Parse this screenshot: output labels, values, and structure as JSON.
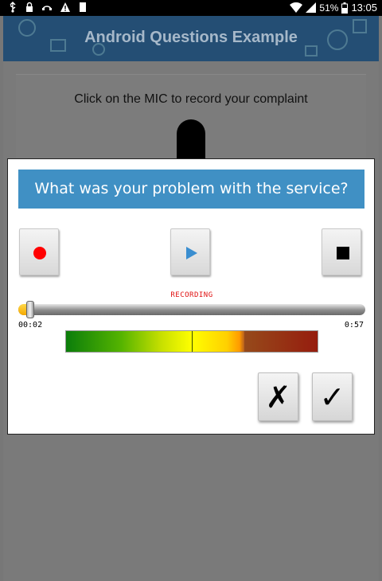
{
  "status_bar": {
    "battery": "51%",
    "time": "13:05",
    "left_icons": [
      "usb-icon",
      "lock-icon",
      "voicemail-icon",
      "warning-icon",
      "sd-card-icon"
    ],
    "right_icons": [
      "wifi-icon",
      "signal-icon",
      "battery-icon"
    ]
  },
  "app": {
    "title": "Android Questions Example",
    "question_text": "Click on the MIC to record your complaint",
    "accent_color": "#4090c4"
  },
  "dialog": {
    "title": "What was your problem with the service?",
    "buttons": {
      "record": "record-icon",
      "play": "play-icon",
      "stop": "stop-icon",
      "cancel_symbol": "✗",
      "confirm_symbol": "✓"
    },
    "status_label": "RECORDING",
    "progress": {
      "elapsed": "00:02",
      "total": "0:57",
      "fraction": 0.035
    },
    "level": {
      "fraction": 0.71,
      "peak_fraction": 0.5
    }
  }
}
